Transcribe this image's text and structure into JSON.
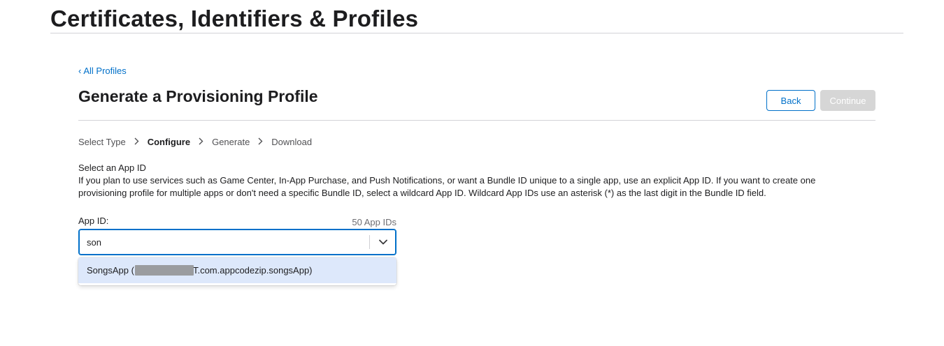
{
  "site": {
    "title": "Certificates, Identifiers & Profiles"
  },
  "nav": {
    "back_link": "All Profiles"
  },
  "page": {
    "title": "Generate a Provisioning Profile"
  },
  "actions": {
    "back_label": "Back",
    "continue_label": "Continue"
  },
  "steps": [
    {
      "label": "Select Type",
      "active": false
    },
    {
      "label": "Configure",
      "active": true
    },
    {
      "label": "Generate",
      "active": false
    },
    {
      "label": "Download",
      "active": false
    }
  ],
  "section": {
    "heading": "Select an App ID",
    "description": "If you plan to use services such as Game Center, In-App Purchase, and Push Notifications, or want a Bundle ID unique to a single app, use an explicit App ID. If you want to create one provisioning profile for multiple apps or don't need a specific Bundle ID, select a wildcard App ID. Wildcard App IDs use an asterisk (*) as the last digit in the Bundle ID field."
  },
  "app_id_field": {
    "label": "App ID:",
    "count": "50 App IDs",
    "value": "son"
  },
  "dropdown": {
    "options": [
      {
        "name": "SongsApp",
        "open_paren": "(",
        "bundle_suffix": "T.com.appcodezip.songsApp)",
        "highlighted": true
      }
    ]
  },
  "colors": {
    "accent": "#0070c9",
    "highlight": "#dde8fb",
    "disabled_button": "#d6d6d6",
    "rule": "#d2d2d7"
  },
  "icons": {
    "back_chevron": "chevron-left-icon",
    "step_separator": "chevron-right-icon",
    "dropdown_toggle": "chevron-down-icon"
  }
}
